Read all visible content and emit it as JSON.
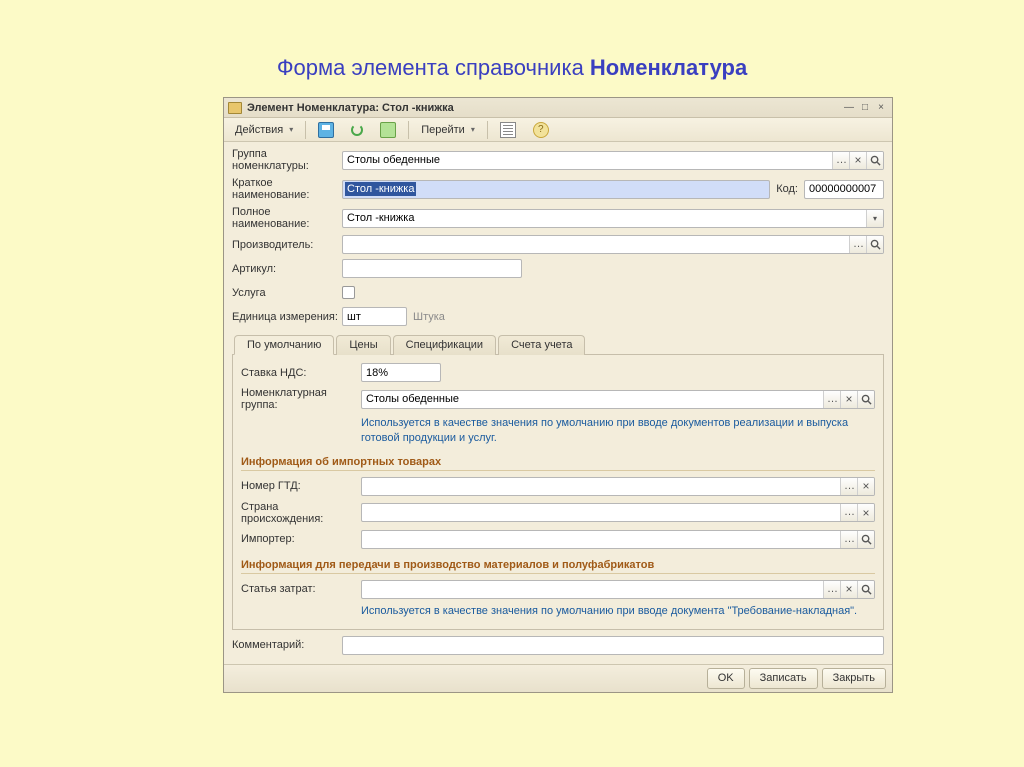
{
  "page_heading_pre": "Форма элемента справочника ",
  "page_heading_bold": "Номенклатура",
  "window": {
    "title": "Элемент Номенклатура: Стол -книжка"
  },
  "toolbar": {
    "actions": "Действия",
    "goto": "Перейти"
  },
  "labels": {
    "group": "Группа номенклатуры:",
    "short_name": "Краткое наименование:",
    "full_name": "Полное наименование:",
    "manufacturer": "Производитель:",
    "sku": "Артикул:",
    "service": "Услуга",
    "unit": "Единица измерения:",
    "code": "Код:",
    "vat": "Ставка НДС:",
    "nom_group": "Номенклатурная группа:",
    "gtd": "Номер ГТД:",
    "country": "Страна происхождения:",
    "importer": "Импортер:",
    "cost_item": "Статья затрат:",
    "comment": "Комментарий:"
  },
  "values": {
    "group": "Столы обеденные",
    "short_name": "Стол -книжка",
    "full_name": "Стол -книжка",
    "code": "00000000007",
    "unit": "шт",
    "unit_desc": "Штука",
    "vat": "18%",
    "nom_group": "Столы обеденные",
    "manufacturer": "",
    "sku": "",
    "gtd": "",
    "country": "",
    "importer": "",
    "cost_item": "",
    "comment": ""
  },
  "tabs": [
    "По умолчанию",
    "Цены",
    "Спецификации",
    "Счета учета"
  ],
  "sections": {
    "import": "Информация об импортных товарах",
    "production": "Информация для передачи в производство материалов и полуфабрикатов"
  },
  "hints": {
    "nom_group": "Используется в качестве значения по умолчанию при вводе документов  реализации и выпуска готовой продукции и услуг.",
    "cost_item": "Используется в качестве значения по умолчанию при вводе документа \"Требование-накладная\"."
  },
  "footer": {
    "ok": "OK",
    "write": "Записать",
    "close": "Закрыть"
  }
}
